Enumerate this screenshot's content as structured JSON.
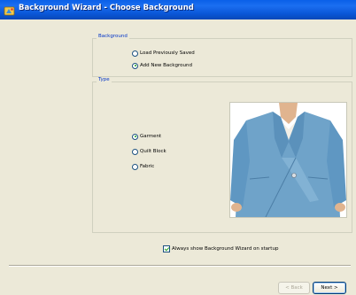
{
  "window": {
    "title": "Background Wizard - Choose Background",
    "icon": "wizard-app-icon",
    "titlebar_color": "#0a57d8"
  },
  "background_group": {
    "legend": "Background",
    "options": [
      {
        "label": "Load Previously Saved",
        "selected": false
      },
      {
        "label": "Add New Background",
        "selected": true
      }
    ]
  },
  "type_group": {
    "legend": "Type",
    "options": [
      {
        "label": "Garment",
        "selected": true
      },
      {
        "label": "Quilt Block",
        "selected": false
      },
      {
        "label": "Fabric",
        "selected": false
      }
    ],
    "preview_icon": "blue-jacket-photo"
  },
  "startup_checkbox": {
    "label": "Always show Background Wizard on startup",
    "checked": true
  },
  "buttons": {
    "back": "< Back",
    "next": "Next >"
  },
  "colors": {
    "dialog_bg": "#ece9d8",
    "legend_text": "#0033c8",
    "jacket_blue": "#6fa3c9"
  }
}
